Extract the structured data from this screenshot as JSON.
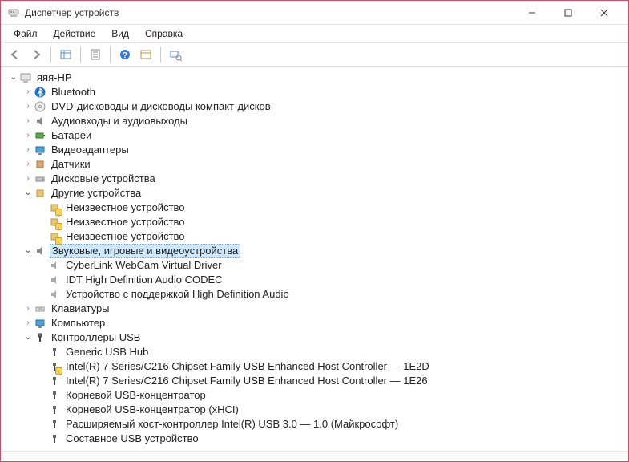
{
  "window": {
    "title": "Диспетчер устройств"
  },
  "menu": {
    "file": "Файл",
    "action": "Действие",
    "view": "Вид",
    "help": "Справка"
  },
  "tree": {
    "root": "яяя-HP",
    "bluetooth": "Bluetooth",
    "dvd": "DVD-дисководы и дисководы компакт-дисков",
    "audio_io": "Аудиовходы и аудиовыходы",
    "batteries": "Батареи",
    "video_adapters": "Видеоадаптеры",
    "sensors": "Датчики",
    "disk_drives": "Дисковые устройства",
    "other": "Другие устройства",
    "other_items": {
      "u1": "Неизвестное устройство",
      "u2": "Неизвестное устройство",
      "u3": "Неизвестное устройство"
    },
    "sound": "Звуковые, игровые и видеоустройства",
    "sound_items": {
      "s1": "CyberLink WebCam Virtual Driver",
      "s2": "IDT High Definition Audio CODEC",
      "s3": "Устройство с поддержкой High Definition Audio"
    },
    "keyboards": "Клавиатуры",
    "computer": "Компьютер",
    "usb": "Контроллеры USB",
    "usb_items": {
      "g1": "Generic USB Hub",
      "g2": "Intel(R) 7 Series/C216 Chipset Family USB Enhanced Host Controller — 1E2D",
      "g3": "Intel(R) 7 Series/C216 Chipset Family USB Enhanced Host Controller — 1E26",
      "g4": "Корневой USB-концентратор",
      "g5": "Корневой USB-концентратор (xHCI)",
      "g6": "Расширяемый хост-контроллер Intel(R) USB 3.0 — 1.0 (Майкрософт)",
      "g7": "Составное USB устройство"
    }
  }
}
